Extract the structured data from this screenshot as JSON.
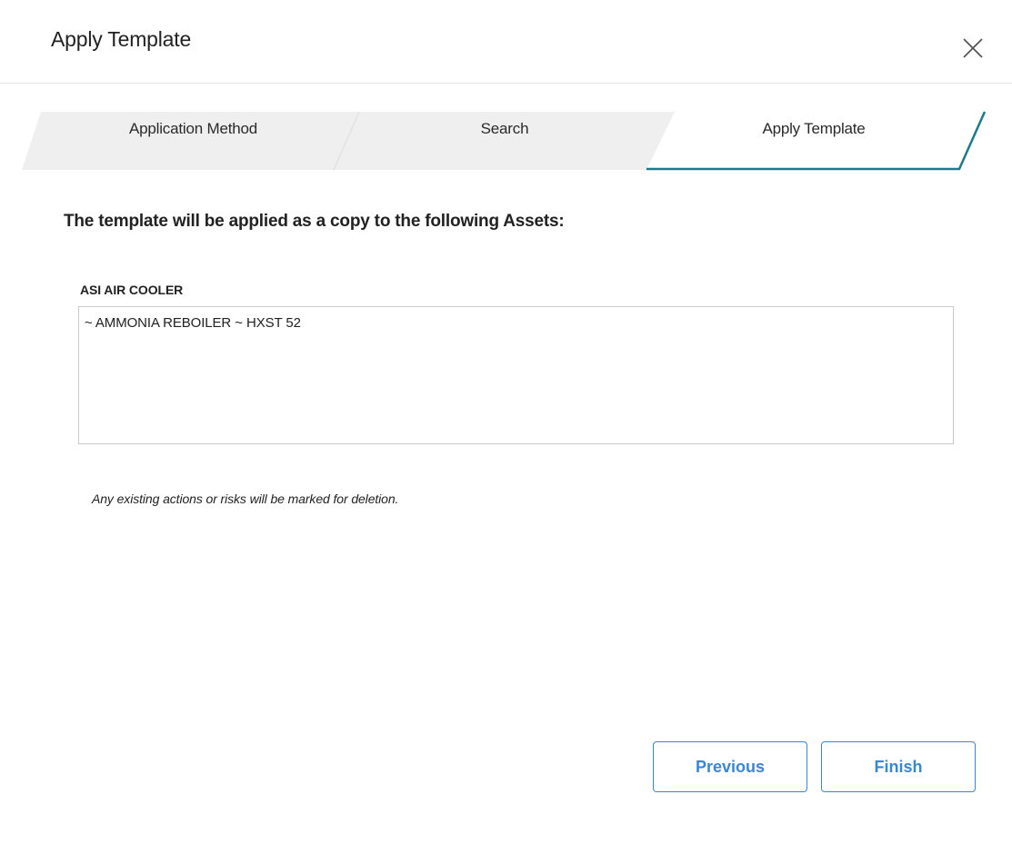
{
  "dialog": {
    "title": "Apply Template"
  },
  "wizard": {
    "steps": [
      {
        "label": "Application Method",
        "active": false
      },
      {
        "label": "Search",
        "active": false
      },
      {
        "label": "Apply Template",
        "active": true
      }
    ],
    "active_color": "#1b7a8c",
    "inactive_color": "#efefef"
  },
  "content": {
    "intro": "The template will be applied as a copy to the following Assets:",
    "asset_group_label": "ASI AIR COOLER",
    "assets": [
      "~ AMMONIA REBOILER ~ HXST 52"
    ],
    "note": "Any existing actions or risks will be marked for deletion."
  },
  "footer": {
    "previous_label": "Previous",
    "finish_label": "Finish",
    "button_color": "#3a86d6"
  }
}
